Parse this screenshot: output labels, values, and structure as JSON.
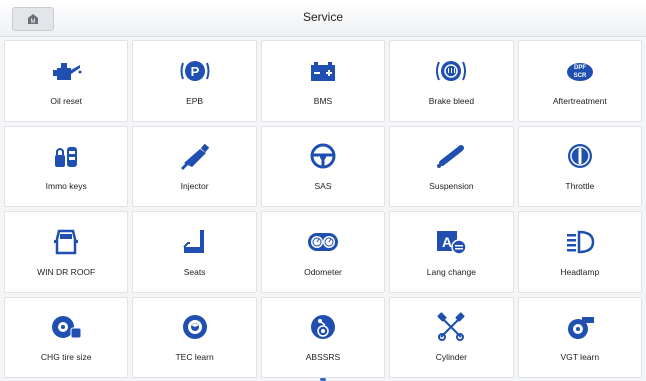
{
  "header": {
    "title": "Service",
    "home_icon": "home-icon"
  },
  "colors": {
    "accent": "#1f4fb0",
    "tile_bg": "#ffffff",
    "page_bg": "#f4f5f7"
  },
  "tiles": [
    {
      "label": "Oil reset",
      "icon": "oil-can-icon"
    },
    {
      "label": "EPB",
      "icon": "parking-brake-icon"
    },
    {
      "label": "BMS",
      "icon": "battery-icon"
    },
    {
      "label": "Brake bleed",
      "icon": "brake-bleed-icon"
    },
    {
      "label": "Aftertreatment",
      "icon": "dpf-scr-icon"
    },
    {
      "label": "Immo keys",
      "icon": "immo-key-icon"
    },
    {
      "label": "Injector",
      "icon": "injector-icon"
    },
    {
      "label": "SAS",
      "icon": "steering-wheel-icon"
    },
    {
      "label": "Suspension",
      "icon": "suspension-icon"
    },
    {
      "label": "Throttle",
      "icon": "throttle-icon"
    },
    {
      "label": "WIN DR ROOF",
      "icon": "car-door-icon"
    },
    {
      "label": "Seats",
      "icon": "seat-icon"
    },
    {
      "label": "Odometer",
      "icon": "odometer-icon"
    },
    {
      "label": "Lang change",
      "icon": "language-icon"
    },
    {
      "label": "Headlamp",
      "icon": "headlamp-icon"
    },
    {
      "label": "CHG tire size",
      "icon": "tire-icon"
    },
    {
      "label": "TEC learn",
      "icon": "gear-learn-icon"
    },
    {
      "label": "ABSSRS",
      "icon": "abs-srs-icon"
    },
    {
      "label": "Cylinder",
      "icon": "cylinder-icon"
    },
    {
      "label": "VGT learn",
      "icon": "turbo-icon"
    }
  ]
}
